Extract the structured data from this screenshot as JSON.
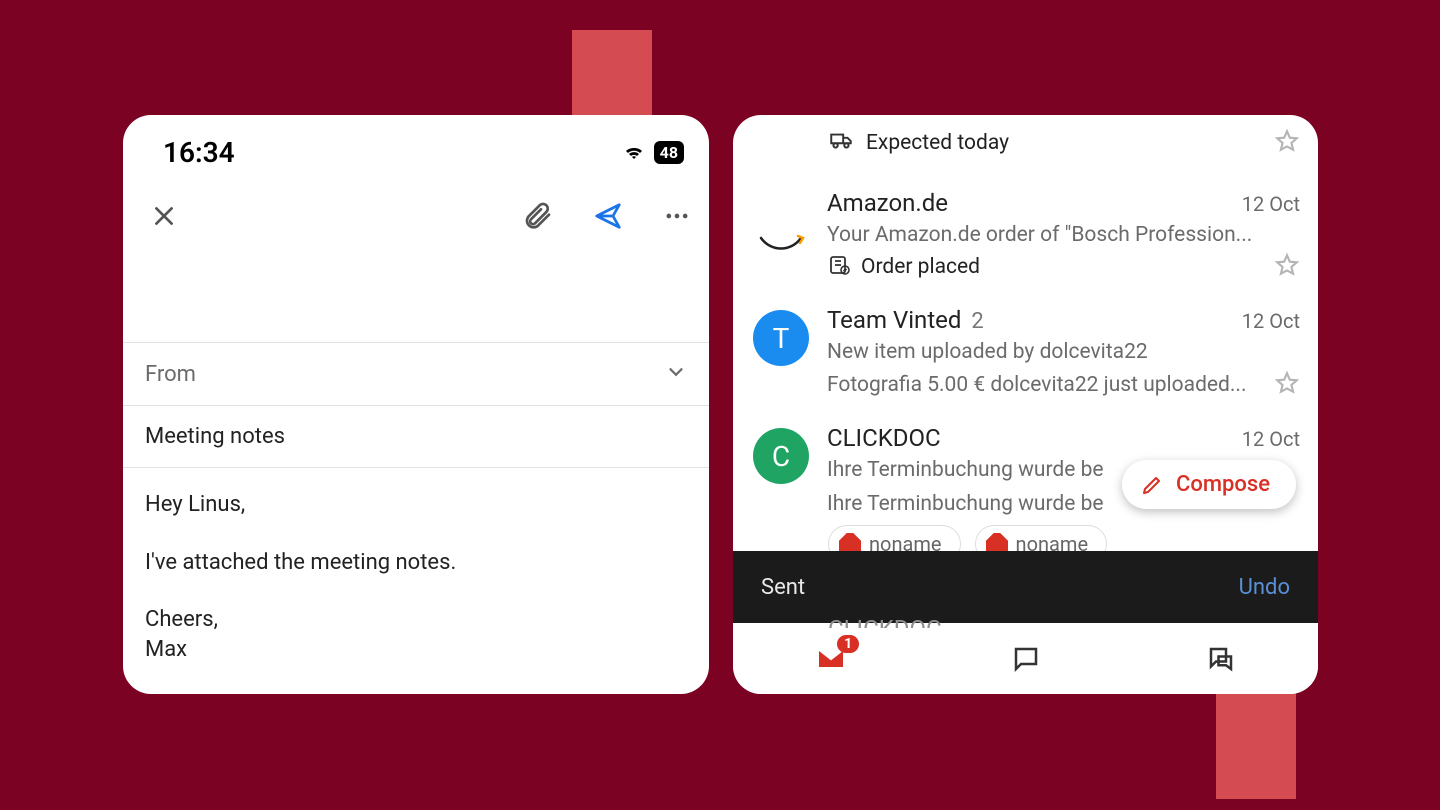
{
  "status": {
    "time": "16:34",
    "battery": "48"
  },
  "compose": {
    "from_label": "From",
    "subject": "Meeting notes",
    "body_greeting": "Hey Linus,",
    "body_text": "I've attached the meeting notes.",
    "body_signoff": "Cheers,",
    "body_name": "Max"
  },
  "inbox": {
    "first_meta": "Expected today",
    "items": [
      {
        "sender": "Amazon.de",
        "date": "12 Oct",
        "snippet": "Your Amazon.de order of \"Bosch Profession...",
        "status": "Order placed"
      },
      {
        "avatar_letter": "T",
        "sender": "Team Vinted",
        "count": "2",
        "date": "12 Oct",
        "snippet_l1": "New item uploaded by dolcevita22",
        "snippet_l2": "Fotografia 5.00 € dolcevita22 just uploaded..."
      },
      {
        "avatar_letter": "C",
        "sender": "CLICKDOC",
        "date": "12 Oct",
        "snippet_l1": "Ihre Terminbuchung wurde be",
        "snippet_l2": "Ihre Terminbuchung wurde be",
        "chip": "noname"
      }
    ],
    "below_snack_sender": "CLICKDOC",
    "compose_label": "Compose",
    "snackbar_text": "Sent",
    "snackbar_action": "Undo",
    "nav_badge": "1"
  }
}
